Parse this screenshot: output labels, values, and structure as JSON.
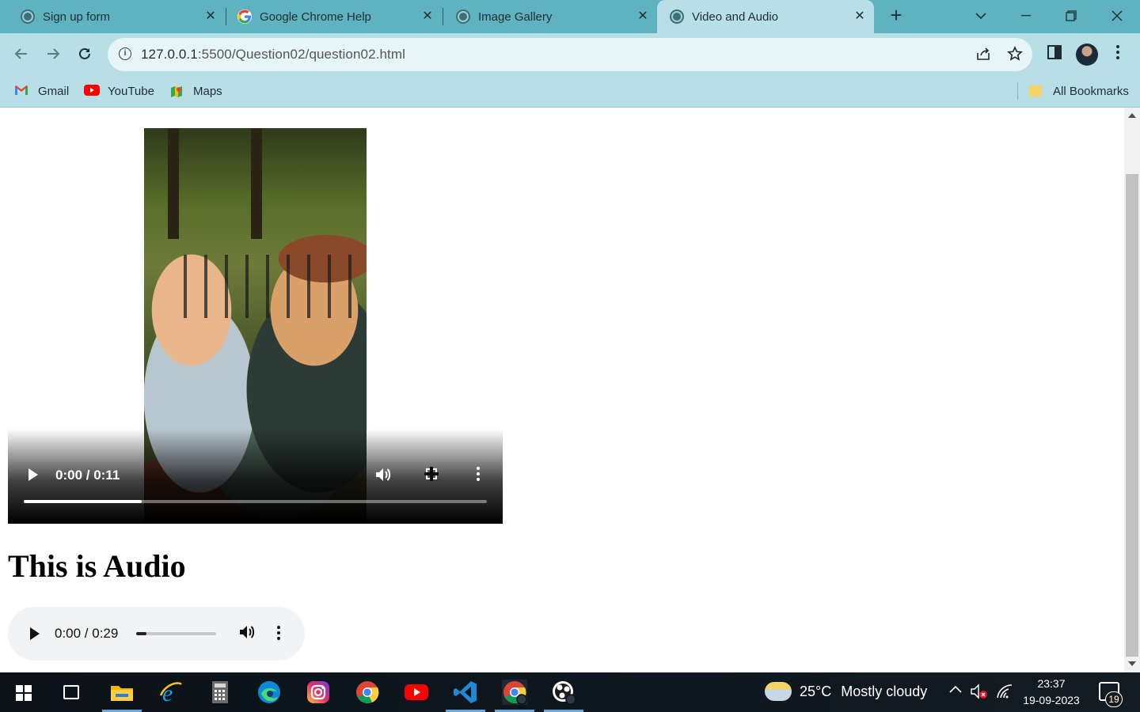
{
  "browser": {
    "tabs": [
      {
        "title": "Sign up form",
        "favicon": "globe-icon",
        "active": false
      },
      {
        "title": "Google Chrome Help",
        "favicon": "google-icon",
        "active": false
      },
      {
        "title": "Image Gallery",
        "favicon": "globe-icon",
        "active": false
      },
      {
        "title": "Video and Audio",
        "favicon": "globe-icon",
        "active": true
      }
    ],
    "close_glyph": "✕",
    "new_tab_glyph": "+",
    "address": {
      "host": "127.0.0.1",
      "path": ":5500/Question02/question02.html"
    },
    "bookmarks": [
      {
        "label": "Gmail",
        "icon": "gmail-icon"
      },
      {
        "label": "YouTube",
        "icon": "youtube-icon"
      },
      {
        "label": "Maps",
        "icon": "maps-icon"
      }
    ],
    "all_bookmarks_label": "All Bookmarks",
    "colors": {
      "frame": "#5fb3c0",
      "toolbar": "#b8dfe5"
    }
  },
  "page": {
    "video": {
      "time": "0:00 / 0:11",
      "progress_fraction": 0.255
    },
    "heading": "This is Audio",
    "audio": {
      "time": "0:00 / 0:29",
      "progress_fraction": 0.13
    }
  },
  "taskbar": {
    "weather": {
      "temp": "25°C",
      "condition": "Mostly cloudy"
    },
    "clock": {
      "time": "23:37",
      "date": "19-09-2023"
    },
    "notifications_count": "19",
    "apps": [
      "file-explorer-icon",
      "internet-explorer-icon",
      "calculator-icon",
      "edge-icon",
      "instagram-icon",
      "chrome-icon",
      "youtube-icon",
      "vscode-icon",
      "chrome-profile-icon",
      "obs-icon"
    ]
  }
}
